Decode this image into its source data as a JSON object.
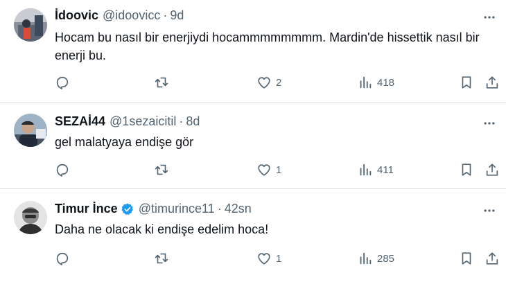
{
  "tweets": [
    {
      "name": "İdoovic",
      "handle": "@idoovicc",
      "time": "9d",
      "text": "Hocam bu nasıl bir enerjiydi hocammmmmmmm. Mardin'de hissettik nasıl bir enerji bu.",
      "likes": "2",
      "views": "418",
      "verified": false
    },
    {
      "name": "SEZAİ44",
      "handle": "@1sezaicitil",
      "time": "8d",
      "text": "gel malatyaya endişe gör",
      "likes": "1",
      "views": "411",
      "verified": false
    },
    {
      "name": "Timur İnce",
      "handle": "@timurince11",
      "time": "42sn",
      "text": "Daha ne olacak ki endişe edelim hoca!",
      "likes": "1",
      "views": "285",
      "verified": true
    }
  ],
  "separator": "·",
  "colors": {
    "text": "#0f1419",
    "secondary": "#536471",
    "verified": "#1d9bf0",
    "divider": "#d7dce0"
  },
  "icons": [
    "reply-icon",
    "retweet-icon",
    "like-icon",
    "views-icon",
    "bookmark-icon",
    "share-icon",
    "more-icon",
    "verified-badge-icon"
  ]
}
